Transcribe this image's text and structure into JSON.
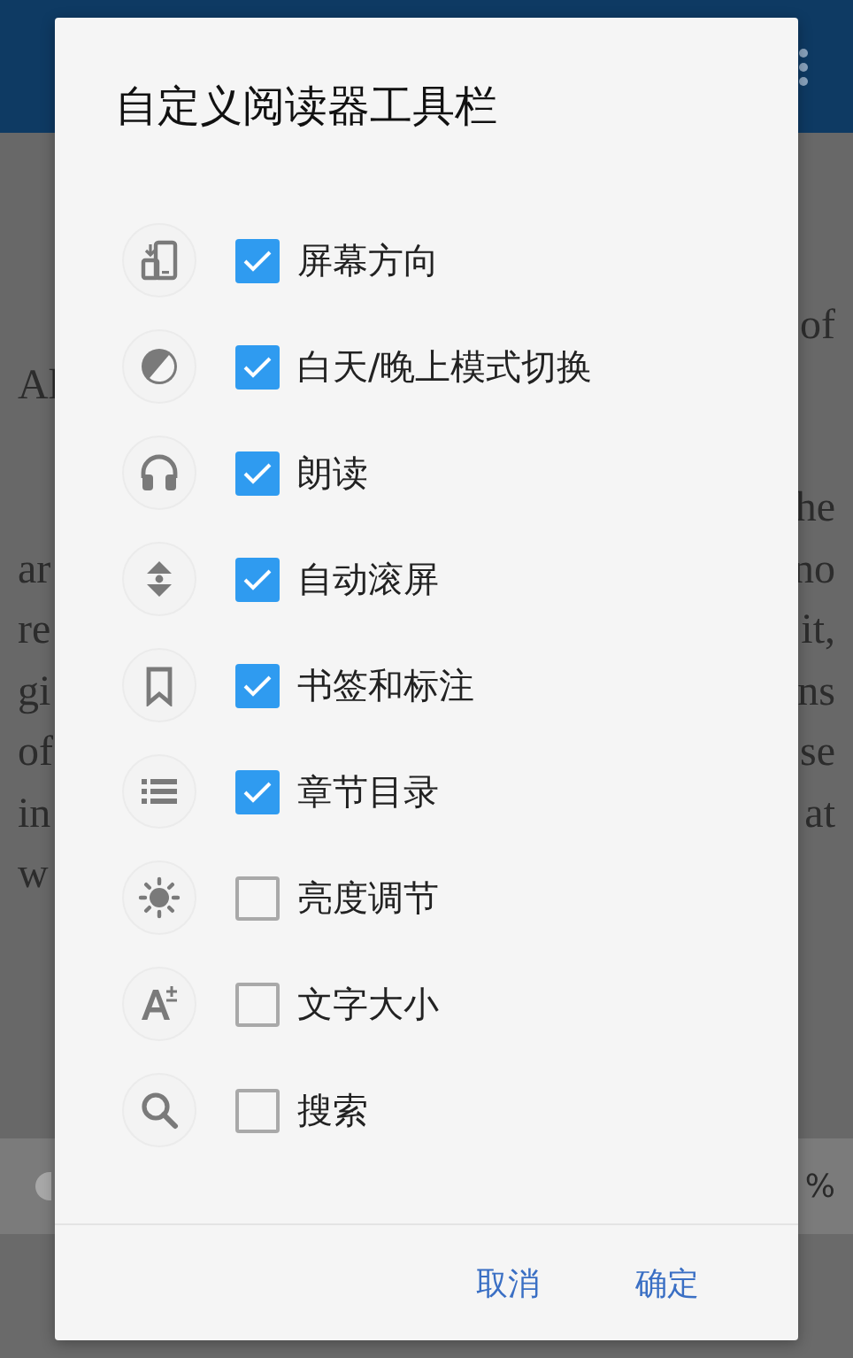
{
  "reader": {
    "lines": [
      {
        "right": "of"
      },
      {
        "left": "Al"
      },
      {
        "right": "he",
        "gap_before": true
      },
      {
        "left": "ar",
        "right": "no"
      },
      {
        "left": "re",
        "right": "it,"
      },
      {
        "left": "gi",
        "right": "ns"
      },
      {
        "left": "of",
        "right": "se"
      },
      {
        "left": "in",
        "right": "at"
      },
      {
        "left": "w"
      }
    ],
    "progress": {
      "reading": "%"
    }
  },
  "dialog": {
    "title": "自定义阅读器工具栏",
    "options": [
      {
        "label": "屏幕方向",
        "checked": true
      },
      {
        "label": "白天/晚上模式切换",
        "checked": true
      },
      {
        "label": "朗读",
        "checked": true
      },
      {
        "label": "自动滚屏",
        "checked": true
      },
      {
        "label": "书签和标注",
        "checked": true
      },
      {
        "label": "章节目录",
        "checked": true
      },
      {
        "label": "亮度调节",
        "checked": false
      },
      {
        "label": "文字大小",
        "checked": false
      },
      {
        "label": "搜索",
        "checked": false
      }
    ],
    "buttons": [
      {
        "label": "取消"
      },
      {
        "label": "确定"
      }
    ]
  }
}
